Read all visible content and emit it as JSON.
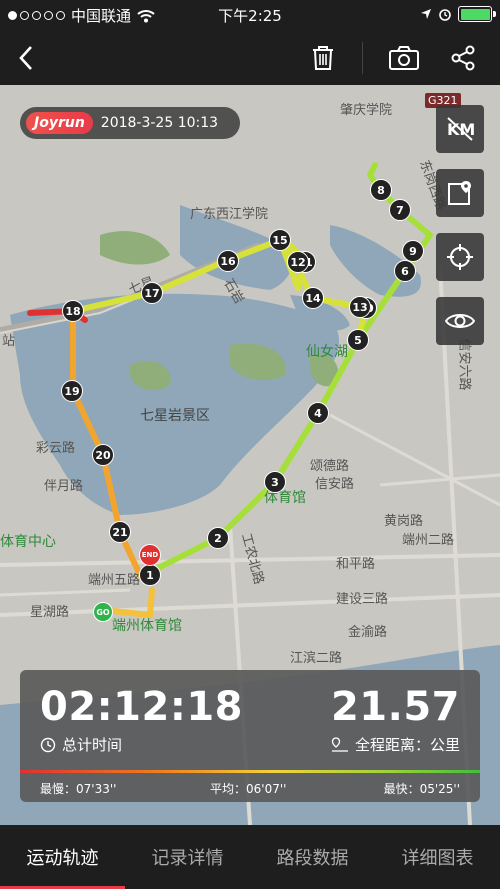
{
  "status_bar": {
    "carrier": "中国联通",
    "time": "下午2:25"
  },
  "badge": {
    "logo": "Joyrun",
    "datetime": "2018-3-25 10:13"
  },
  "side_buttons": [
    "km-toggle",
    "map-pin",
    "locate",
    "visibility"
  ],
  "map_labels": {
    "zhaoqing": "肇庆学院",
    "g321": "G321",
    "xijiang": "广东西江学院",
    "shiyan": "石岩",
    "qixing": "七星",
    "xiannv": "仙女湖",
    "qixingyan": "七星岩景区",
    "caiyun": "彩云路",
    "songcheng": "颂德路",
    "xinan": "信安路",
    "banyue": "伴月路",
    "tiyuguan": "体育馆",
    "tiyuzhongxin": "体育中心",
    "duanzhouwu": "端州五路",
    "huangang": "黄岗路",
    "duanzhouer": "端州二路",
    "heping": "和平路",
    "gongnong": "工农北路",
    "jianshe": "建设三路",
    "xinghu": "星湖路",
    "duanzhoutiyuguan": "端州体育馆",
    "jiangbin": "江滨二路",
    "jinyu": "金渝路",
    "dongjiang": "东岗西路",
    "xinanliu": "信安六路",
    "zhan": "站"
  },
  "markers": [
    "1",
    "2",
    "3",
    "4",
    "5",
    "6",
    "7",
    "8",
    "9",
    "10",
    "11",
    "12",
    "13",
    "14",
    "15",
    "16",
    "17",
    "18",
    "19",
    "20",
    "21"
  ],
  "end_label": "END",
  "go_label": "GO",
  "stats": {
    "duration": "02:12:18",
    "duration_label": "总计时间",
    "distance": "21.57",
    "distance_label": "全程距离：公里",
    "slowest": "最慢：07'33''",
    "average": "平均：06'07''",
    "fastest": "最快：05'25''"
  },
  "tabs": [
    {
      "label": "运动轨迹",
      "active": true
    },
    {
      "label": "记录详情",
      "active": false
    },
    {
      "label": "路段数据",
      "active": false
    },
    {
      "label": "详细图表",
      "active": false
    }
  ]
}
